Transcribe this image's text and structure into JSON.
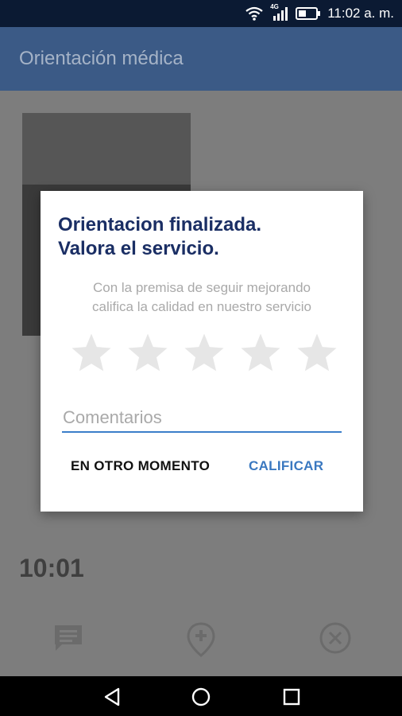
{
  "status_bar": {
    "time": "11:02 a. m.",
    "network_label": "4G"
  },
  "app_bar": {
    "title": "Orientación médica"
  },
  "session": {
    "timer": "10:01"
  },
  "dialog": {
    "title_line1": "Orientacion finalizada.",
    "title_line2": "Valora el servicio.",
    "subtitle_line1": "Con la premisa de seguir mejorando",
    "subtitle_line2": "califica la calidad en nuestro servicio",
    "rating_max": 5,
    "rating_value": 0,
    "comment_placeholder": "Comentarios",
    "comment_value": "",
    "later_button": "EN OTRO MOMENTO",
    "rate_button": "CALIFICAR"
  },
  "actions": [
    {
      "icon": "chat-icon"
    },
    {
      "icon": "location-pin-icon"
    },
    {
      "icon": "end-call-icon"
    }
  ],
  "colors": {
    "accent": "#3a78c0",
    "dialog_title": "#1a2e64",
    "star_empty": "#e6e6e6",
    "input_underline": "#3b7ec9"
  }
}
